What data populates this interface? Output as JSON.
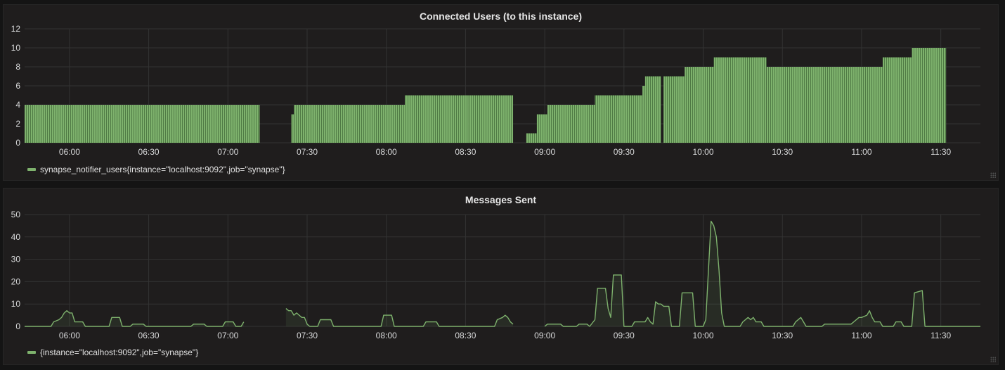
{
  "theme": {
    "background": "#141414",
    "panel_bg": "#1f1d1d",
    "series_color": "#7eb26d",
    "grid_color": "#333333"
  },
  "panels": [
    {
      "title": "Connected Users (to this instance)",
      "legend": "synapse_notifier_users{instance=\"localhost:9092\",job=\"synapse\"}"
    },
    {
      "title": "Messages Sent",
      "legend": "{instance=\"localhost:9092\",job=\"synapse\"}"
    }
  ],
  "chart_data": [
    {
      "type": "bar",
      "title": "Connected Users (to this instance)",
      "xlabel": "",
      "ylabel": "",
      "x_unit": "time",
      "x_range": [
        "05:43",
        "11:45"
      ],
      "x_ticks": [
        "06:00",
        "06:30",
        "07:00",
        "07:30",
        "08:00",
        "08:30",
        "09:00",
        "09:30",
        "10:00",
        "10:30",
        "11:00",
        "11:30"
      ],
      "ylim": [
        0,
        12
      ],
      "y_ticks": [
        0,
        2,
        4,
        6,
        8,
        10,
        12
      ],
      "grid": true,
      "legend_position": "bottom-left",
      "series": [
        {
          "name": "synapse_notifier_users{instance=\"localhost:9092\",job=\"synapse\"}",
          "color": "#7eb26d",
          "steps": [
            [
              "05:43",
              "07:12",
              4
            ],
            [
              "07:24",
              "07:25",
              3
            ],
            [
              "07:25",
              "08:07",
              4
            ],
            [
              "08:07",
              "08:31",
              5
            ],
            [
              "08:31",
              "08:48",
              5
            ],
            [
              "08:53",
              "08:57",
              1
            ],
            [
              "08:57",
              "09:01",
              3
            ],
            [
              "09:01",
              "09:19",
              4
            ],
            [
              "09:19",
              "09:37",
              5
            ],
            [
              "09:37",
              "09:38",
              6
            ],
            [
              "09:38",
              "09:44",
              7
            ],
            [
              "09:45",
              "09:53",
              7
            ],
            [
              "09:53",
              "10:04",
              8
            ],
            [
              "10:04",
              "10:24",
              9
            ],
            [
              "10:24",
              "11:08",
              8
            ],
            [
              "11:08",
              "11:19",
              9
            ],
            [
              "11:19",
              "11:32",
              10
            ]
          ]
        }
      ]
    },
    {
      "type": "line",
      "title": "Messages Sent",
      "xlabel": "",
      "ylabel": "",
      "x_unit": "time",
      "x_range": [
        "05:43",
        "11:45"
      ],
      "x_ticks": [
        "06:00",
        "06:30",
        "07:00",
        "07:30",
        "08:00",
        "08:30",
        "09:00",
        "09:30",
        "10:00",
        "10:30",
        "11:00",
        "11:30"
      ],
      "ylim": [
        0,
        50
      ],
      "y_ticks": [
        0,
        10,
        20,
        30,
        40,
        50
      ],
      "grid": true,
      "legend_position": "bottom-left",
      "series": [
        {
          "name": "{instance=\"localhost:9092\",job=\"synapse\"}",
          "color": "#7eb26d",
          "segments": [
            [
              [
                "05:43",
                0
              ],
              [
                "05:53",
                0
              ],
              [
                "05:54",
                2
              ],
              [
                "05:56",
                3
              ],
              [
                "05:57",
                4
              ],
              [
                "05:58",
                6
              ],
              [
                "05:59",
                7
              ],
              [
                "06:00",
                6
              ],
              [
                "06:01",
                6
              ],
              [
                "06:02",
                2
              ],
              [
                "06:05",
                2
              ],
              [
                "06:06",
                0
              ],
              [
                "06:15",
                0
              ],
              [
                "06:16",
                4
              ],
              [
                "06:19",
                4
              ],
              [
                "06:20",
                0
              ],
              [
                "06:23",
                0
              ],
              [
                "06:24",
                1
              ],
              [
                "06:28",
                1
              ],
              [
                "06:29",
                0
              ],
              [
                "06:46",
                0
              ],
              [
                "06:47",
                1
              ],
              [
                "06:51",
                1
              ],
              [
                "06:52",
                0
              ],
              [
                "06:58",
                0
              ],
              [
                "06:59",
                2
              ],
              [
                "07:02",
                2
              ],
              [
                "07:03",
                0
              ],
              [
                "07:05",
                0
              ],
              [
                "07:06",
                2
              ]
            ],
            [
              [
                "07:22",
                8
              ],
              [
                "07:23",
                7
              ],
              [
                "07:24",
                7
              ],
              [
                "07:25",
                5
              ],
              [
                "07:26",
                6
              ],
              [
                "07:27",
                5
              ],
              [
                "07:28",
                4
              ],
              [
                "07:29",
                4
              ],
              [
                "07:30",
                1
              ],
              [
                "07:31",
                0
              ],
              [
                "07:34",
                0
              ],
              [
                "07:35",
                3
              ],
              [
                "07:39",
                3
              ],
              [
                "07:40",
                0
              ],
              [
                "07:58",
                0
              ],
              [
                "07:59",
                5
              ],
              [
                "08:02",
                5
              ],
              [
                "08:03",
                0
              ],
              [
                "08:14",
                0
              ],
              [
                "08:15",
                2
              ],
              [
                "08:19",
                2
              ],
              [
                "08:20",
                0
              ],
              [
                "08:41",
                0
              ],
              [
                "08:42",
                3
              ],
              [
                "08:44",
                4
              ],
              [
                "08:45",
                5
              ],
              [
                "08:46",
                4
              ],
              [
                "08:47",
                2
              ],
              [
                "08:48",
                1
              ]
            ],
            [
              [
                "09:00",
                0
              ],
              [
                "09:01",
                1
              ],
              [
                "09:06",
                1
              ],
              [
                "09:07",
                0
              ],
              [
                "09:12",
                0
              ],
              [
                "09:13",
                1
              ],
              [
                "09:16",
                1
              ],
              [
                "09:17",
                0
              ],
              [
                "09:19",
                3
              ],
              [
                "09:20",
                17
              ],
              [
                "09:23",
                17
              ],
              [
                "09:24",
                8
              ],
              [
                "09:25",
                4
              ],
              [
                "09:26",
                23
              ],
              [
                "09:29",
                23
              ],
              [
                "09:30",
                0
              ],
              [
                "09:33",
                0
              ],
              [
                "09:34",
                2
              ],
              [
                "09:38",
                2
              ],
              [
                "09:39",
                4
              ],
              [
                "09:40",
                2
              ],
              [
                "09:41",
                1
              ],
              [
                "09:42",
                11
              ],
              [
                "09:43",
                10
              ],
              [
                "09:44",
                10
              ],
              [
                "09:45",
                9
              ],
              [
                "09:47",
                9
              ],
              [
                "09:48",
                0
              ],
              [
                "09:51",
                0
              ],
              [
                "09:52",
                15
              ],
              [
                "09:56",
                15
              ],
              [
                "09:57",
                0
              ],
              [
                "10:00",
                0
              ],
              [
                "10:01",
                3
              ],
              [
                "10:02",
                25
              ],
              [
                "10:03",
                47
              ],
              [
                "10:04",
                45
              ],
              [
                "10:05",
                40
              ],
              [
                "10:06",
                25
              ],
              [
                "10:07",
                6
              ],
              [
                "10:08",
                0
              ],
              [
                "10:14",
                0
              ],
              [
                "10:15",
                2
              ],
              [
                "10:17",
                4
              ],
              [
                "10:18",
                3
              ],
              [
                "10:19",
                4
              ],
              [
                "10:20",
                2
              ],
              [
                "10:22",
                2
              ],
              [
                "10:23",
                0
              ],
              [
                "10:34",
                0
              ],
              [
                "10:35",
                2
              ],
              [
                "10:37",
                4
              ],
              [
                "10:38",
                2
              ],
              [
                "10:39",
                0
              ],
              [
                "10:45",
                0
              ],
              [
                "10:46",
                1
              ],
              [
                "10:56",
                1
              ],
              [
                "10:57",
                2
              ],
              [
                "10:59",
                4
              ],
              [
                "11:00",
                4
              ],
              [
                "11:02",
                5
              ],
              [
                "11:03",
                7
              ],
              [
                "11:04",
                4
              ],
              [
                "11:05",
                2
              ],
              [
                "11:07",
                2
              ],
              [
                "11:08",
                0
              ],
              [
                "11:12",
                0
              ],
              [
                "11:13",
                2
              ],
              [
                "11:15",
                2
              ],
              [
                "11:16",
                0
              ],
              [
                "11:19",
                0
              ],
              [
                "11:20",
                15
              ],
              [
                "11:23",
                16
              ],
              [
                "11:24",
                0
              ],
              [
                "11:45",
                0
              ]
            ]
          ]
        }
      ]
    }
  ]
}
